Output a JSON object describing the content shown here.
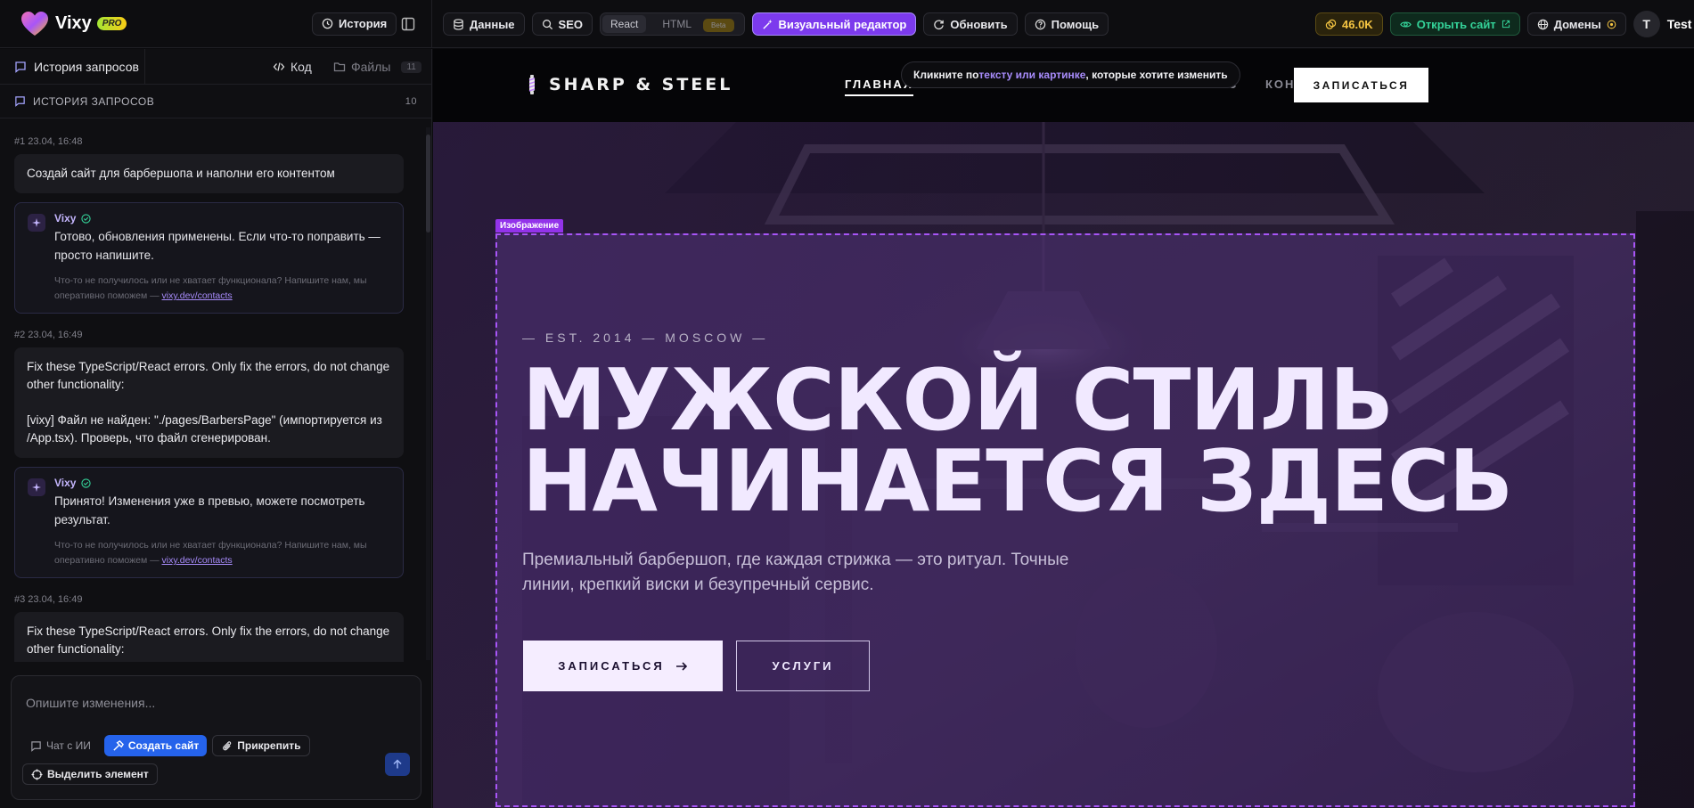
{
  "app": {
    "name": "Vixy",
    "badge": "PRO",
    "history_button": "История"
  },
  "toolbar": {
    "data_label": "Данные",
    "seo_label": "SEO",
    "mode_react": "React",
    "mode_html": "HTML",
    "mode_html_badge": "Beta",
    "visual_editor_label": "Визуальный редактор",
    "refresh_label": "Обновить",
    "help_label": "Помощь",
    "tokens": "46.0K",
    "open_site_label": "Открыть сайт",
    "domains_label": "Домены",
    "user_initial": "T",
    "user_name": "Test"
  },
  "left_panel": {
    "tab_history": "История запросов",
    "tab_code": "Код",
    "tab_files": "Файлы",
    "files_count": "11",
    "section_title": "ИСТОРИЯ ЗАПРОСОВ",
    "section_count": "10",
    "requests": [
      {
        "meta": "#1  23.04, 16:48",
        "user_text": "Создай сайт для барбершопа и наполни его контентом",
        "bot_name": "Vixy",
        "bot_text": "Готово, обновления применены. Если что-то поправить — просто напишите.",
        "hint_text": "Что-то не получилось или не хватает функционала? Напишите нам, мы оперативно поможем — ",
        "hint_link": "vixy.dev/contacts"
      },
      {
        "meta": "#2  23.04, 16:49",
        "user_text_line1": "Fix these TypeScript/React errors. Only fix the errors, do not change other functionality:",
        "user_text_line2": "[vixy] Файл не найден: \"./pages/BarbersPage\" (импортируется из /App.tsx). Проверь, что файл сгенерирован.",
        "bot_name": "Vixy",
        "bot_text": "Принято! Изменения уже в превью, можете посмотреть результат.",
        "hint_text": "Что-то не получилось или не хватает функционала? Напишите нам, мы оперативно поможем — ",
        "hint_link": "vixy.dev/contacts"
      },
      {
        "meta": "#3  23.04, 16:49",
        "user_text": "Fix these TypeScript/React errors. Only fix the errors, do not change other functionality:"
      }
    ],
    "composer": {
      "placeholder": "Опишите изменения...",
      "chat_label": "Чат с ИИ",
      "create_label": "Создать сайт",
      "attach_label": "Прикрепить",
      "select_label": "Выделить элемент"
    }
  },
  "preview": {
    "logo_text": "SHARP & STEEL",
    "nav": {
      "home": "ГЛАВНАЯ",
      "hidden_partial": "С",
      "contacts": "КОНТАКТЫ",
      "cta": "ЗАПИСАТЬСЯ"
    },
    "tooltip": {
      "prefix": "Кликните по ",
      "highlight": "тексту или картинке",
      "suffix": ", которые хотите изменить"
    },
    "selection_tag": "Изображение",
    "hero": {
      "eyebrow": "— EST. 2014 — MOSCOW —",
      "title_line1": "МУЖСКОЙ СТИЛЬ",
      "title_line2": "НАЧИНАЕТСЯ ЗДЕСЬ",
      "subtitle": "Премиальный барбершоп, где каждая стрижка — это ритуал. Точные линии, крепкий виски и безупречный сервис.",
      "primary_button": "ЗАПИСАТЬСЯ",
      "secondary_button": "УСЛУГИ"
    }
  }
}
